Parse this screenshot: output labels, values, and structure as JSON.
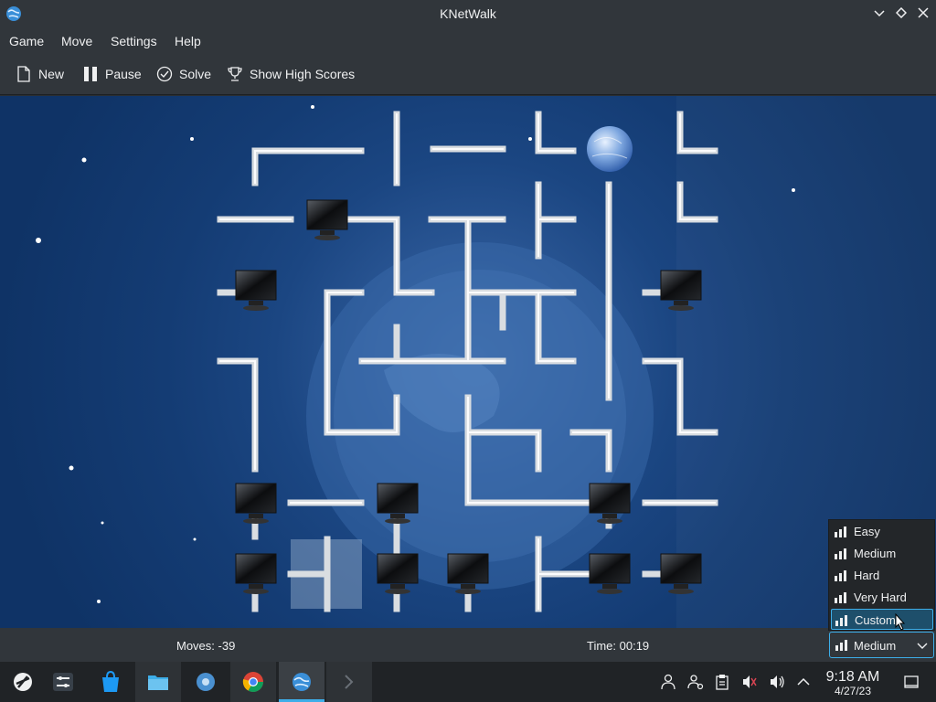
{
  "window": {
    "title": "KNetWalk"
  },
  "menu": [
    "Game",
    "Move",
    "Settings",
    "Help"
  ],
  "toolbar": {
    "new": "New",
    "pause": "Pause",
    "solve": "Solve",
    "scores": "Show High Scores"
  },
  "status": {
    "moves": "Moves: -39",
    "time": "Time: 00:19"
  },
  "difficulty": {
    "current": "Medium",
    "options": [
      "Easy",
      "Medium",
      "Hard",
      "Very Hard",
      "Custom"
    ],
    "highlighted": "Custom"
  },
  "clock": {
    "time": "9:18 AM",
    "date": "4/27/23"
  },
  "icons": {
    "app": "knetwalk-globe-icon",
    "taskbar": [
      "plasma-launcher-icon",
      "system-settings-sliders-icon",
      "discover-store-icon",
      "file-manager-icon",
      "settings-gear-icon",
      "chrome-icon",
      "knetwalk-icon",
      "terminal-icon"
    ],
    "tray": [
      "user-icon",
      "accounts-icon",
      "clipboard-icon",
      "audio-muted-icon",
      "volume-icon",
      "tray-expand-icon",
      "show-desktop-icon"
    ]
  },
  "colors": {
    "accent": "#3daee9",
    "window_bg": "#31363b",
    "board_bg": "#1b4682"
  }
}
